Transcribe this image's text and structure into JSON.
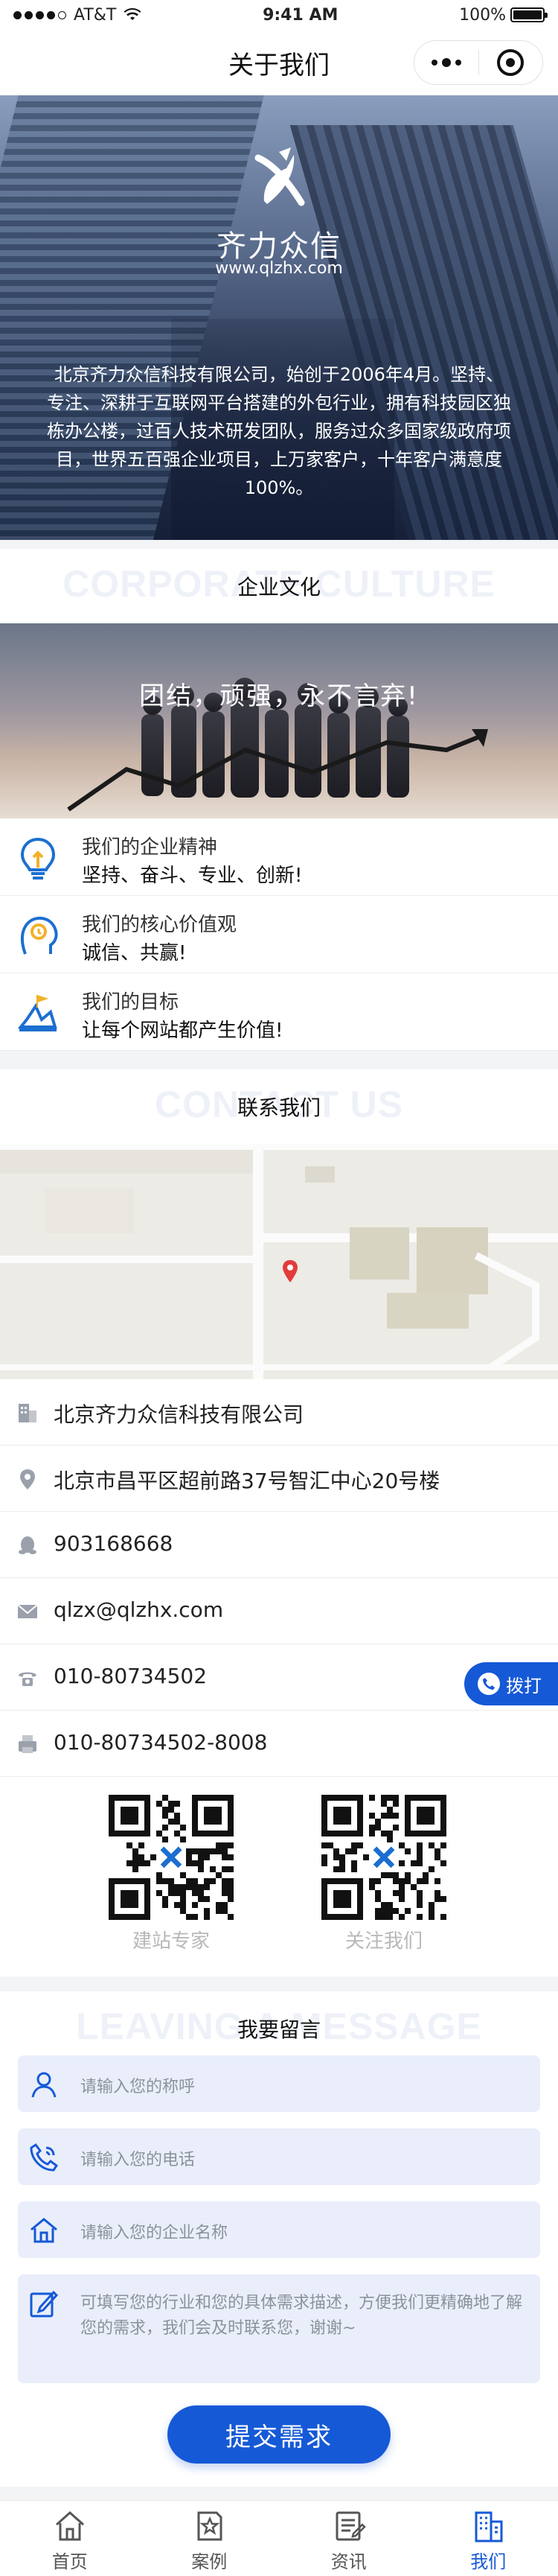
{
  "status": {
    "carrier": "AT&T",
    "time": "9:41 AM",
    "battery": "100%"
  },
  "nav": {
    "title": "关于我们"
  },
  "hero": {
    "brand": "齐力众信",
    "url": "www.qlzhx.com",
    "intro": "北京齐力众信科技有限公司，始创于2006年4月。坚持、专注、深耕于互联网平台搭建的外包行业，拥有科技园区独栋办公楼，过百人技术研发团队，服务过众多国家级政府项目，世界五百强企业项目，上万家客户，十年客户满意度100%。"
  },
  "culture": {
    "ghost": "CORPORATE CULTURE",
    "title": "企业文化",
    "slogan": "团结，顽强，永不言弃!",
    "items": [
      {
        "icon": "lightbulb-icon",
        "label": "我们的企业精神",
        "value": "坚持、奋斗、专业、创新!"
      },
      {
        "icon": "person-idea-icon",
        "label": "我们的核心价值观",
        "value": "诚信、共赢!"
      },
      {
        "icon": "target-goal-icon",
        "label": "我们的目标",
        "value": "让每个网站都产生价值!"
      }
    ]
  },
  "contact": {
    "ghost": "CONTACT US",
    "title": "联系我们",
    "items": [
      {
        "icon": "building-icon",
        "text": "北京齐力众信科技有限公司"
      },
      {
        "icon": "location-pin-icon",
        "text": "北京市昌平区超前路37号智汇中心20号楼"
      },
      {
        "icon": "qq-icon",
        "text": "903168668"
      },
      {
        "icon": "mail-icon",
        "text": "qlzx@qlzhx.com"
      },
      {
        "icon": "phone-icon",
        "text": "010-80734502"
      },
      {
        "icon": "fax-icon",
        "text": "010-80734502-8008"
      }
    ],
    "call_label": "拨打",
    "qr": [
      {
        "label": "建站专家"
      },
      {
        "label": "关注我们"
      }
    ]
  },
  "message": {
    "ghost": "LEAVING A MESSAGE",
    "title": "我要留言",
    "name_placeholder": "请输入您的称呼",
    "phone_placeholder": "请输入您的电话",
    "company_placeholder": "请输入您的企业名称",
    "needs_placeholder": "可填写您的行业和您的具体需求描述，方便我们更精确地了解您的需求，我们会及时联系您，谢谢~",
    "submit": "提交需求"
  },
  "tabs": [
    {
      "icon": "home-icon",
      "label": "首页"
    },
    {
      "icon": "star-doc-icon",
      "label": "案例"
    },
    {
      "icon": "news-icon",
      "label": "资讯"
    },
    {
      "icon": "company-icon",
      "label": "我们",
      "active": true
    }
  ],
  "colors": {
    "accent": "#1659d6",
    "field_bg": "#e9eefa",
    "icon_blue": "#1c6fd0",
    "icon_yellow": "#f2b12a"
  }
}
